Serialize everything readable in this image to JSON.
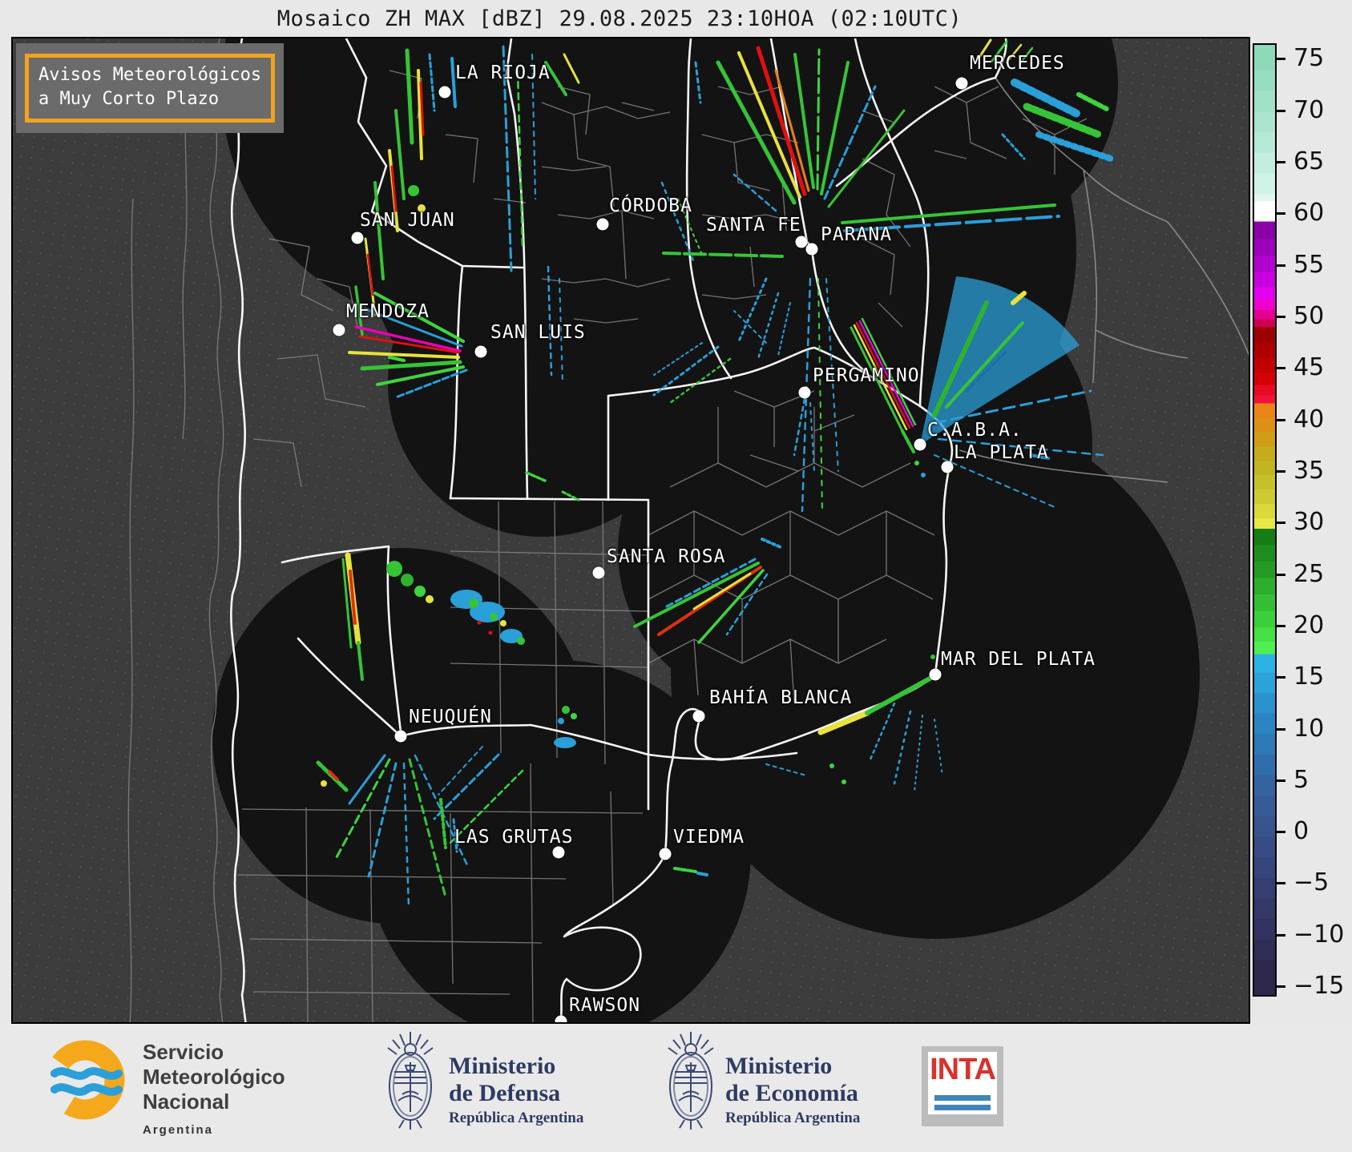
{
  "title": "Mosaico ZH MAX [dBZ] 29.08.2025 23:10HOA (02:10UTC)",
  "advisory": {
    "line1": "Avisos Meteorológicos",
    "line2": "a Muy Corto Plazo",
    "border_color": "#f2a31e"
  },
  "colorbar": {
    "unit": "dBZ",
    "ticks": [
      75,
      70,
      65,
      60,
      55,
      50,
      45,
      40,
      35,
      30,
      25,
      20,
      15,
      10,
      5,
      0,
      -5,
      -10,
      -15
    ],
    "stops": [
      {
        "v": 76.5,
        "c": "#8ed9ba"
      },
      {
        "v": 74,
        "c": "#97ddc1"
      },
      {
        "v": 72,
        "c": "#a1e1c8"
      },
      {
        "v": 70,
        "c": "#abe5cf"
      },
      {
        "v": 68,
        "c": "#b7e9d7"
      },
      {
        "v": 66,
        "c": "#c3eedf"
      },
      {
        "v": 64,
        "c": "#d1f2e7"
      },
      {
        "v": 62,
        "c": "#e0f7f0"
      },
      {
        "v": 61.3,
        "c": "#ffffff"
      },
      {
        "v": 59.3,
        "c": "#8a00a6"
      },
      {
        "v": 57.6,
        "c": "#9d00bb"
      },
      {
        "v": 56,
        "c": "#b100cf"
      },
      {
        "v": 54.4,
        "c": "#c800e0"
      },
      {
        "v": 52.9,
        "c": "#e400ee"
      },
      {
        "v": 51.7,
        "c": "#ef00cd"
      },
      {
        "v": 50.7,
        "c": "#e30092"
      },
      {
        "v": 49.8,
        "c": "#cd0050"
      },
      {
        "v": 49,
        "c": "#9c0000"
      },
      {
        "v": 47.5,
        "c": "#ae0000"
      },
      {
        "v": 46,
        "c": "#c10000"
      },
      {
        "v": 44.6,
        "c": "#d40007"
      },
      {
        "v": 43.4,
        "c": "#e60b22"
      },
      {
        "v": 42.4,
        "c": "#f41337"
      },
      {
        "v": 41.6,
        "c": "#e98617"
      },
      {
        "v": 40.2,
        "c": "#dc9115"
      },
      {
        "v": 38.8,
        "c": "#cf9e18"
      },
      {
        "v": 37.4,
        "c": "#c5ab1e"
      },
      {
        "v": 36,
        "c": "#c1b524"
      },
      {
        "v": 34.6,
        "c": "#c5c12c"
      },
      {
        "v": 33.2,
        "c": "#cdcb34"
      },
      {
        "v": 31.8,
        "c": "#d9d93c"
      },
      {
        "v": 30.4,
        "c": "#e7e746"
      },
      {
        "v": 29.4,
        "c": "#157d15"
      },
      {
        "v": 27.8,
        "c": "#1d8d1d"
      },
      {
        "v": 26.2,
        "c": "#249c24"
      },
      {
        "v": 24.6,
        "c": "#2cad2c"
      },
      {
        "v": 23,
        "c": "#33be33"
      },
      {
        "v": 21.4,
        "c": "#3bcf3b"
      },
      {
        "v": 19.8,
        "c": "#44e044"
      },
      {
        "v": 18.4,
        "c": "#4fef4f"
      },
      {
        "v": 17.2,
        "c": "#2db3e3"
      },
      {
        "v": 15.4,
        "c": "#2ba3d9"
      },
      {
        "v": 13.4,
        "c": "#2a93cd"
      },
      {
        "v": 11.4,
        "c": "#2b85c3"
      },
      {
        "v": 9.4,
        "c": "#2e79b7"
      },
      {
        "v": 7.4,
        "c": "#316dac"
      },
      {
        "v": 5.4,
        "c": "#3463a1"
      },
      {
        "v": 3.4,
        "c": "#365b97"
      },
      {
        "v": 1.4,
        "c": "#37548e"
      },
      {
        "v": -0.6,
        "c": "#374c84"
      },
      {
        "v": -2.6,
        "c": "#36457a"
      },
      {
        "v": -4.6,
        "c": "#353e71"
      },
      {
        "v": -6.6,
        "c": "#333867"
      },
      {
        "v": -8.6,
        "c": "#31325d"
      },
      {
        "v": -10.6,
        "c": "#2f2d54"
      },
      {
        "v": -12.6,
        "c": "#2d284b"
      },
      {
        "v": -16,
        "c": "#2b2443"
      }
    ]
  },
  "map": {
    "cities": [
      {
        "id": "la-rioja",
        "name": "LA RIOJA",
        "dot": [
          539,
          67
        ],
        "label": [
          552,
          32
        ]
      },
      {
        "id": "mercedes",
        "name": "MERCEDES",
        "dot": [
          1184,
          56
        ],
        "label": [
          1194,
          20
        ]
      },
      {
        "id": "san-juan",
        "name": "SAN JUAN",
        "dot": [
          430,
          249
        ],
        "label": [
          433,
          216
        ]
      },
      {
        "id": "cordoba",
        "name": "CÓRDOBA",
        "dot": [
          736,
          232
        ],
        "label": [
          744,
          198
        ]
      },
      {
        "id": "santa-fe",
        "name": "SANTA FE",
        "dot": [
          984,
          254
        ],
        "label": [
          865,
          222
        ]
      },
      {
        "id": "parana",
        "name": "PARANA",
        "dot": [
          997,
          263
        ],
        "label": [
          1008,
          234
        ]
      },
      {
        "id": "mendoza",
        "name": "MENDOZA",
        "dot": [
          407,
          364
        ],
        "label": [
          416,
          330
        ]
      },
      {
        "id": "san-luis",
        "name": "SAN LUIS",
        "dot": [
          584,
          391
        ],
        "label": [
          596,
          356
        ]
      },
      {
        "id": "pergamino",
        "name": "PERGAMINO",
        "dot": [
          988,
          442
        ],
        "label": [
          998,
          410
        ]
      },
      {
        "id": "caba",
        "name": "C.A.B.A.",
        "dot": [
          1132,
          507
        ],
        "label": [
          1141,
          478
        ]
      },
      {
        "id": "la-plata",
        "name": "LA PLATA",
        "dot": [
          1166,
          535
        ],
        "label": [
          1174,
          506
        ]
      },
      {
        "id": "santa-rosa",
        "name": "SANTA ROSA",
        "dot": [
          731,
          667
        ],
        "label": [
          741,
          636
        ]
      },
      {
        "id": "mar-del-plata",
        "name": "MAR DEL PLATA",
        "dot": [
          1151,
          794
        ],
        "label": [
          1158,
          764
        ]
      },
      {
        "id": "neuquen",
        "name": "NEUQUÉN",
        "dot": [
          484,
          871
        ],
        "label": [
          494,
          836
        ]
      },
      {
        "id": "bahia-blanca",
        "name": "BAHÍA BLANCA",
        "dot": [
          856,
          846
        ],
        "label": [
          869,
          812
        ]
      },
      {
        "id": "las-grutas",
        "name": "LAS GRUTAS",
        "dot": [
          681,
          1016
        ],
        "label": [
          551,
          986
        ]
      },
      {
        "id": "viedma",
        "name": "VIEDMA",
        "dot": [
          814,
          1018
        ],
        "label": [
          824,
          986
        ]
      },
      {
        "id": "rawson",
        "name": "RAWSON",
        "dot": [
          684,
          1227
        ],
        "label": [
          694,
          1196
        ]
      }
    ]
  },
  "footer": {
    "smn": {
      "line1": "Servicio",
      "line2": "Meteorológico",
      "line3": "Nacional",
      "line4": "Argentina"
    },
    "defensa": {
      "line1": "Ministerio",
      "line2": "de Defensa",
      "line3": "República Argentina"
    },
    "economia": {
      "line1": "Ministerio",
      "line2": "de Economía",
      "line3": "República Argentina"
    },
    "inta": {
      "label": "INTA"
    }
  }
}
